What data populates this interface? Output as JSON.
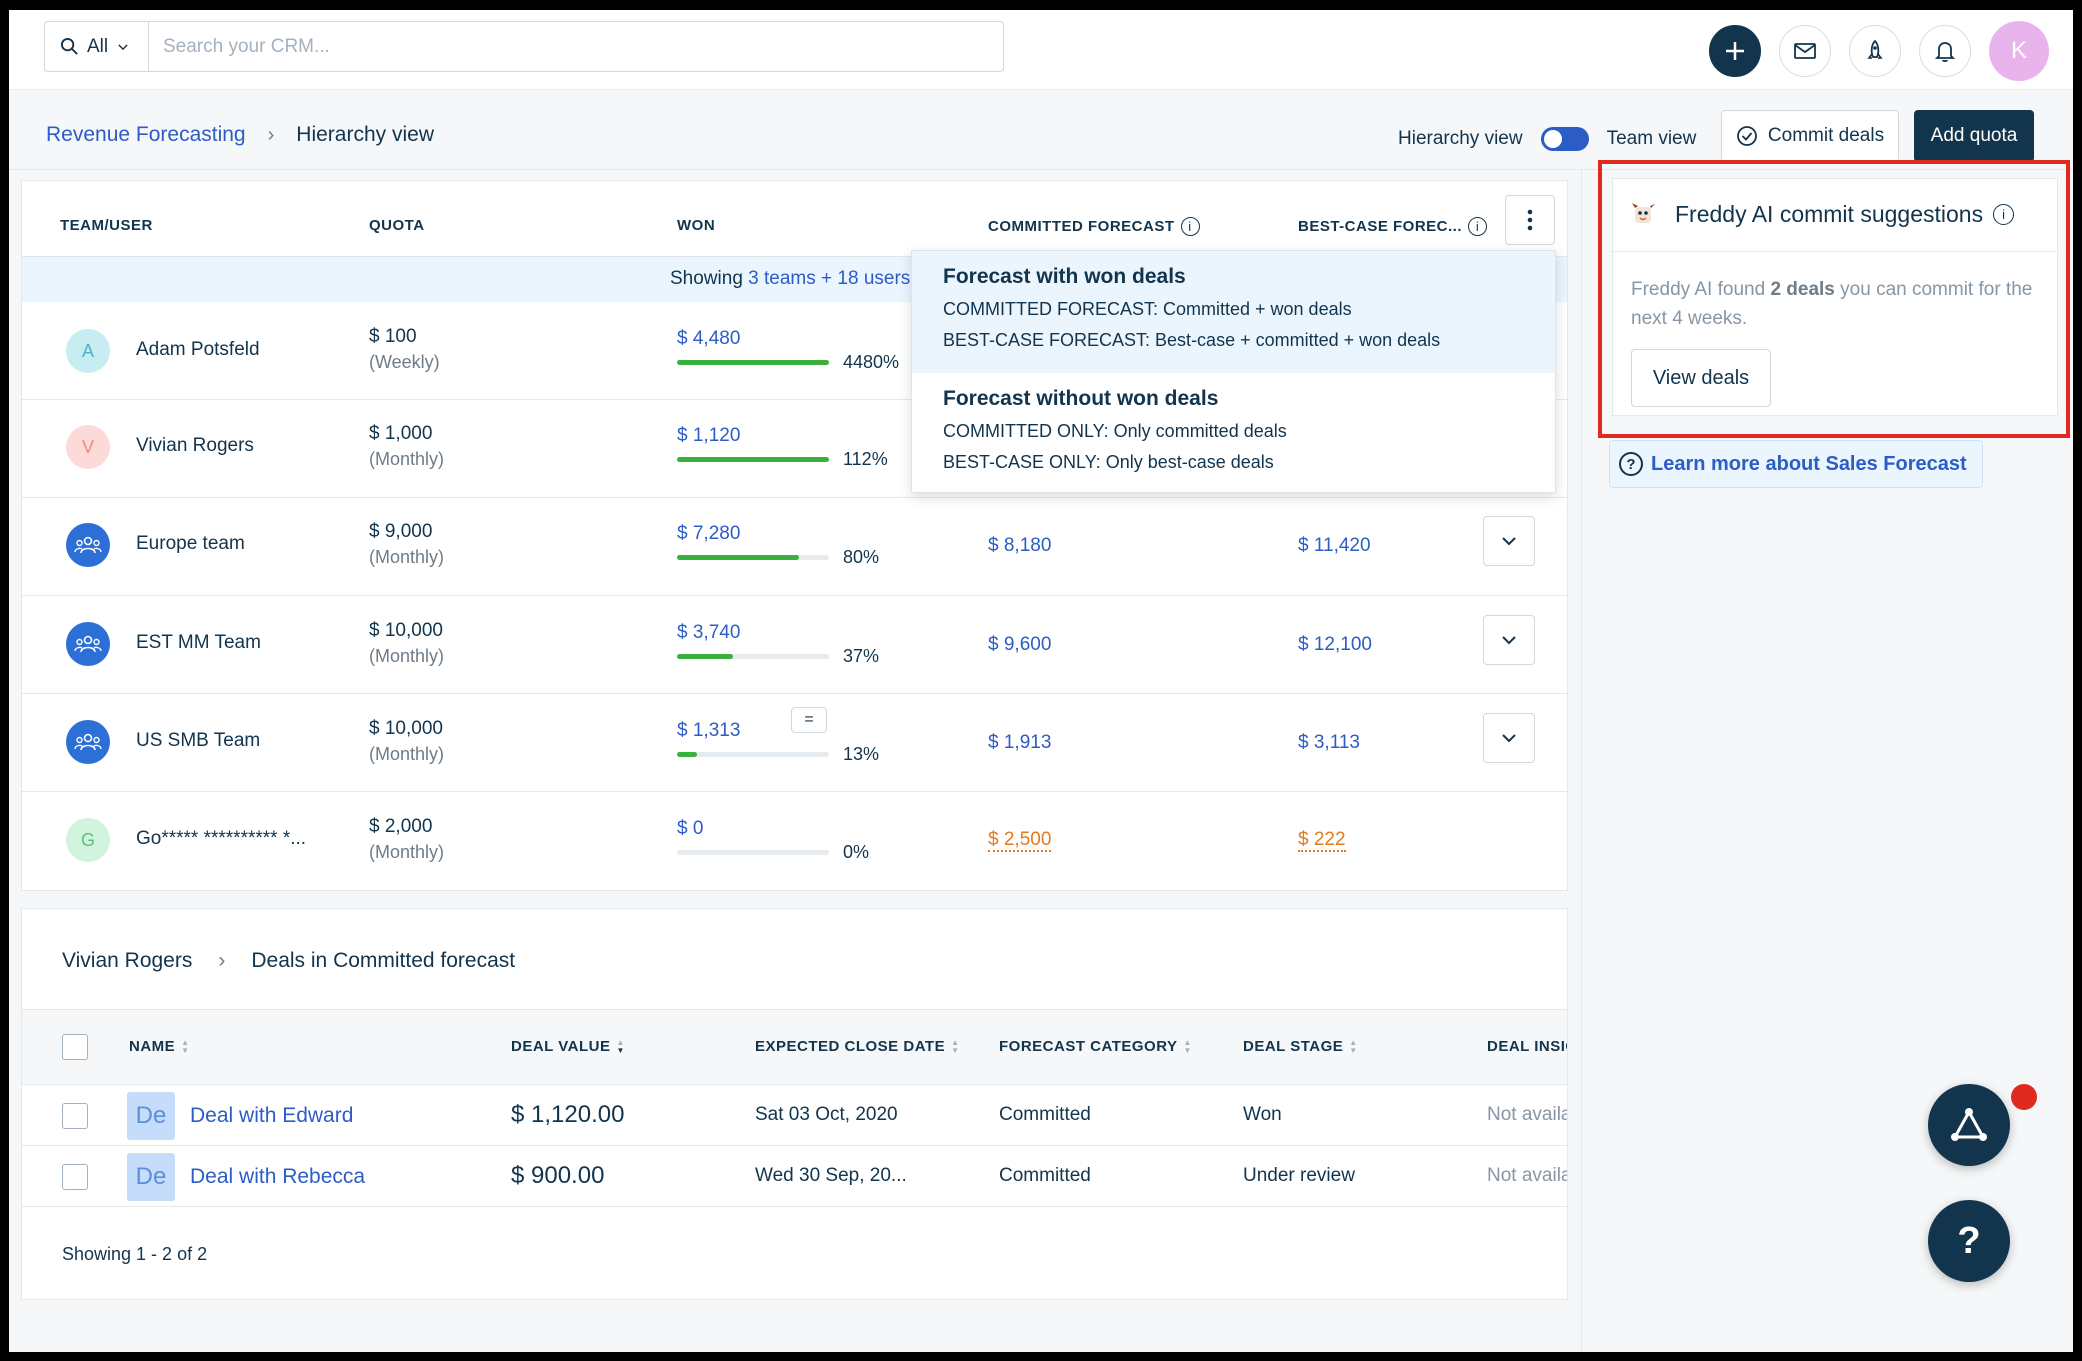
{
  "topbar": {
    "search_scope": "All",
    "search_placeholder": "Search your CRM...",
    "avatar_initial": "K",
    "icons": [
      "search-icon",
      "chevron-down-icon",
      "plus-icon",
      "mail-icon",
      "rocket-icon",
      "bell-icon"
    ]
  },
  "header": {
    "breadcrumb_root": "Revenue Forecasting",
    "breadcrumb_sep": "›",
    "breadcrumb_current": "Hierarchy view",
    "toggle_left": "Hierarchy view",
    "toggle_right": "Team view",
    "commit_button": "Commit deals",
    "add_quota_button": "Add quota"
  },
  "table": {
    "columns": {
      "team_user": "TEAM/USER",
      "quota": "QUOTA",
      "won": "WON",
      "committed": "COMMITTED FORECAST",
      "best_case": "BEST-CASE FOREC..."
    },
    "showing_prefix": "Showing",
    "showing_link": "3 teams + 18 users",
    "rows": [
      {
        "initial": "A",
        "name": "Adam Potsfeld",
        "quota": "$ 100",
        "period": "(Weekly)",
        "won": "$ 4,480",
        "pct": "4480%",
        "fill": 1.0,
        "committed": "",
        "best": ""
      },
      {
        "initial": "V",
        "name": "Vivian Rogers",
        "quota": "$ 1,000",
        "period": "(Monthly)",
        "won": "$ 1,120",
        "pct": "112%",
        "fill": 1.0,
        "committed": "",
        "best": ""
      },
      {
        "initial": "",
        "name": "Europe team",
        "quota": "$ 9,000",
        "period": "(Monthly)",
        "won": "$ 7,280",
        "pct": "80%",
        "fill": 0.8,
        "committed": "$ 8,180",
        "best": "$ 11,420"
      },
      {
        "initial": "",
        "name": "EST MM Team",
        "quota": "$ 10,000",
        "period": "(Monthly)",
        "won": "$ 3,740",
        "pct": "37%",
        "fill": 0.37,
        "committed": "$ 9,600",
        "best": "$ 12,100"
      },
      {
        "initial": "",
        "name": "US SMB Team",
        "quota": "$ 10,000",
        "period": "(Monthly)",
        "won": "$ 1,313",
        "pct": "13%",
        "fill": 0.13,
        "committed": "$ 1,913",
        "best": "$ 3,113"
      },
      {
        "initial": "G",
        "name": "Go***** ********** *...",
        "quota": "$ 2,000",
        "period": "(Monthly)",
        "won": "$ 0",
        "pct": "0%",
        "fill": 0,
        "committed": "$ 2,500",
        "best": "$ 222"
      }
    ],
    "resize_handle": "="
  },
  "dropdown": {
    "opt1_title": "Forecast with won deals",
    "opt1_line1": "COMMITTED FORECAST: Committed + won deals",
    "opt1_line2": "BEST-CASE FORECAST: Best-case + committed + won deals",
    "opt2_title": "Forecast without won deals",
    "opt2_line1": "COMMITTED ONLY: Only committed deals",
    "opt2_line2": "BEST-CASE ONLY: Only best-case deals"
  },
  "deals": {
    "crumb_user": "Vivian Rogers",
    "crumb_sep": "›",
    "crumb_title": "Deals in Committed forecast",
    "columns": {
      "name": "NAME",
      "value": "DEAL VALUE",
      "close_date": "EXPECTED CLOSE DATE",
      "category": "FORECAST CATEGORY",
      "stage": "DEAL STAGE",
      "insights": "DEAL INSIG"
    },
    "rows": [
      {
        "avatar": "De",
        "name": "Deal with Edward",
        "value": "$ 1,120.00",
        "date": "Sat 03 Oct, 2020",
        "category": "Committed",
        "stage": "Won",
        "insights": "Not availab"
      },
      {
        "avatar": "De",
        "name": "Deal with Rebecca",
        "value": "$ 900.00",
        "date": "Wed 30 Sep, 20...",
        "category": "Committed",
        "stage": "Under review",
        "insights": "Not availab"
      }
    ],
    "footer": "Showing 1 - 2 of 2"
  },
  "freddy": {
    "title": "Freddy AI commit suggestions",
    "text_pre": "Freddy AI found",
    "text_bold": "2 deals",
    "text_post": "you can commit for the next 4 weeks.",
    "button": "View deals",
    "learn_more": "Learn more about Sales Forecast"
  },
  "fab": {
    "help": "?"
  },
  "colors": {
    "primary": "#12344d",
    "link": "#2c5cc5",
    "success": "#3ab03e",
    "warning": "#e27a1f",
    "highlight": "#e02a20"
  }
}
